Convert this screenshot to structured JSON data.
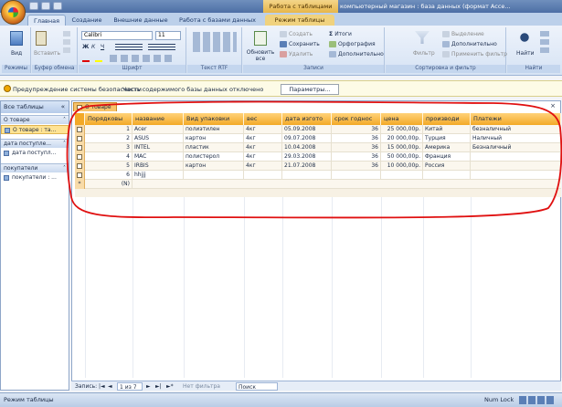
{
  "window": {
    "context_tab": "Работа с таблицами",
    "title": "компьютерный магазин : база данных (формат Acce..."
  },
  "ribbon_tabs": [
    {
      "label": "Главная",
      "active": true
    },
    {
      "label": "Создание"
    },
    {
      "label": "Внешние данные"
    },
    {
      "label": "Работа с базами данных"
    },
    {
      "label": "Режим таблицы",
      "contextual": true
    }
  ],
  "ribbon": {
    "groups": {
      "views": "Режимы",
      "clipboard": "Буфер обмена",
      "font": "Шрифт",
      "rich_text": "Текст RTF",
      "records": "Записи",
      "sort_filter": "Сортировка и фильтр",
      "find": "Найти"
    },
    "view_button": "Вид",
    "paste_button": "Вставить",
    "font_name": "Calibri",
    "font_size": "11",
    "refresh_all": "Обновить все",
    "records": {
      "new": "Создать",
      "save": "Сохранить",
      "delete": "Удалить",
      "totals": "Итоги",
      "spelling": "Орфография",
      "more": "Дополнительно"
    },
    "filter": {
      "filter_button": "Фильтр",
      "selection": "Выделение",
      "advanced": "Дополнительно",
      "toggle": "Применить фильтр"
    },
    "find_button": "Найти"
  },
  "message_bar": {
    "title": "Предупреждение системы безопасности",
    "text": "Часть содержимого базы данных отключено",
    "button": "Параметры..."
  },
  "nav_pane": {
    "header": "Все таблицы",
    "groups": [
      {
        "label": "О товаре",
        "items": [
          {
            "label": "О товаре : та...",
            "selected": true
          }
        ]
      },
      {
        "label": "дата поступле...",
        "items": [
          {
            "label": "дата поступл..."
          }
        ]
      },
      {
        "label": "покупатели",
        "items": [
          {
            "label": "покупатели : ..."
          }
        ]
      }
    ]
  },
  "document_tab": "О товаре",
  "table": {
    "columns": [
      "Порядковы",
      "название",
      "Вид упаковки",
      "вес",
      "дата изгото",
      "срок годнос",
      "цена",
      "производи",
      "Платежи"
    ],
    "rows": [
      [
        "1",
        "Acer",
        "полиэтилен",
        "4кг",
        "05.09.2008",
        "36",
        "25 000,00р.",
        "Китай",
        "безналичный"
      ],
      [
        "2",
        "ASUS",
        "картон",
        "4кг",
        "09.07.2008",
        "36",
        "20 000,00р.",
        "Турция",
        "Наличный"
      ],
      [
        "3",
        "INTEL",
        "пластик",
        "4кг",
        "10.04.2008",
        "36",
        "15 000,00р.",
        "Америка",
        "Безналичный"
      ],
      [
        "4",
        "MAC",
        "полистерол",
        "4кг",
        "29.03.2008",
        "36",
        "50 000,00р.",
        "Франция",
        ""
      ],
      [
        "5",
        "IRBIS",
        "картон",
        "4кг",
        "21.07.2008",
        "36",
        "10 000,00р.",
        "Россия",
        ""
      ],
      [
        "6",
        "hhjjj",
        "",
        "",
        "",
        "",
        "",
        "",
        ""
      ]
    ],
    "new_row_marker": "(N)"
  },
  "record_nav": {
    "record_label": "Запись:",
    "current": "1 из 7",
    "filter_label": "Нет фильтра",
    "search_label": "Поиск"
  },
  "status": {
    "mode": "Режим таблицы",
    "num_lock": "Num Lock"
  },
  "colors": {
    "ribbon_blue": "#bcd0ea",
    "header_orange": "#f3a927",
    "annotation_red": "#e01010"
  }
}
